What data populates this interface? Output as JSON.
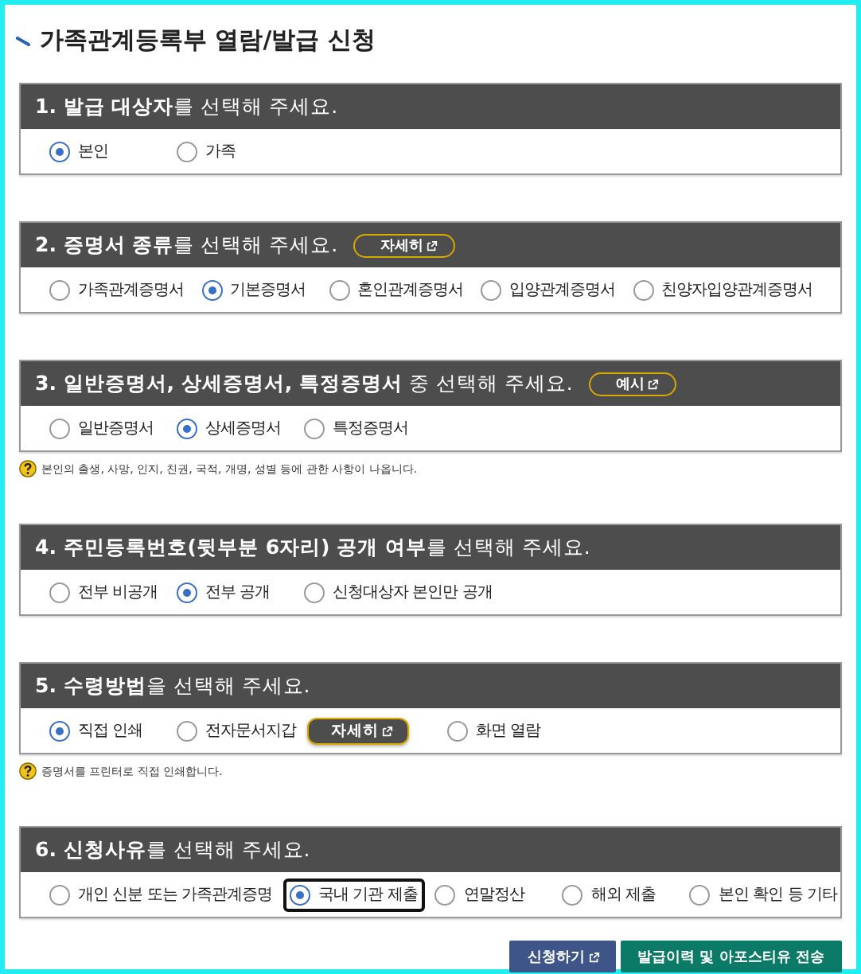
{
  "title": "가족관계등록부 열람/발급 신청",
  "sections": [
    {
      "heading": "**1. 발급 대상자**를 선택해 주세요.",
      "options": [
        {
          "kind": "radio",
          "label": "본인",
          "selected": true
        },
        {
          "kind": "radio",
          "label": "가족",
          "selected": false
        }
      ]
    },
    {
      "heading": "**2. 증명서 종류**를 선택해 주세요.",
      "header_button": "자세히",
      "options": [
        {
          "kind": "radio",
          "label": "가족관계증명서",
          "selected": false
        },
        {
          "kind": "radio",
          "label": "기본증명서",
          "selected": true
        },
        {
          "kind": "radio",
          "label": "혼인관계증명서",
          "selected": false
        },
        {
          "kind": "radio",
          "label": "입양관계증명서",
          "selected": false
        },
        {
          "kind": "radio",
          "label": "친양자입양관계증명서",
          "selected": false
        }
      ]
    },
    {
      "heading": "**3. 일반증명서, 상세증명서, 특정증명서** 중 선택해 주세요.",
      "header_button": "예시",
      "options": [
        {
          "kind": "radio",
          "label": "일반증명서",
          "selected": false
        },
        {
          "kind": "radio",
          "label": "상세증명서",
          "selected": true
        },
        {
          "kind": "radio",
          "label": "특정증명서",
          "selected": false
        }
      ],
      "note": "본인의 출생, 사망, 인지, 친권, 국적, 개명, 성별 등에 관한 사항이 나옵니다."
    },
    {
      "heading": "**4. 주민등록번호(뒷부분 6자리) 공개 여부**를 선택해 주세요.",
      "options": [
        {
          "kind": "radio",
          "label": "전부 비공개",
          "selected": false
        },
        {
          "kind": "radio",
          "label": "전부 공개",
          "selected": true
        },
        {
          "kind": "radio",
          "label": "신청대상자 본인만 공개",
          "selected": false
        }
      ]
    },
    {
      "heading": "**5. 수령방법**을 선택해 주세요.",
      "options": [
        {
          "kind": "radio",
          "label": "직접 인쇄",
          "selected": true
        },
        {
          "kind": "radio",
          "label": "전자문서지갑",
          "selected": false
        },
        {
          "kind": "button",
          "label": "자세히"
        },
        {
          "kind": "radio",
          "label": "화면 열람",
          "selected": false
        }
      ],
      "note": "증명서를 프린터로 직접 인쇄합니다."
    },
    {
      "heading": "**6. 신청사유**를 선택해 주세요.",
      "options": [
        {
          "kind": "radio",
          "label": "개인 신분 또는 가족관계증명",
          "selected": false,
          "focused": false
        },
        {
          "kind": "radio",
          "label": "국내 기관 제출",
          "selected": true,
          "focused": true
        },
        {
          "kind": "radio",
          "label": "연말정산",
          "selected": false,
          "focused": false
        },
        {
          "kind": "radio",
          "label": "해외 제출",
          "selected": false,
          "focused": false
        },
        {
          "kind": "radio",
          "label": "본인 확인 등 기타",
          "selected": false,
          "focused": false
        }
      ]
    }
  ],
  "actions": [
    {
      "kind": "primary",
      "label": "신청하기",
      "external": true
    },
    {
      "kind": "secondary",
      "label": "발급이력 및 아포스티유 전송",
      "external": false
    }
  ]
}
